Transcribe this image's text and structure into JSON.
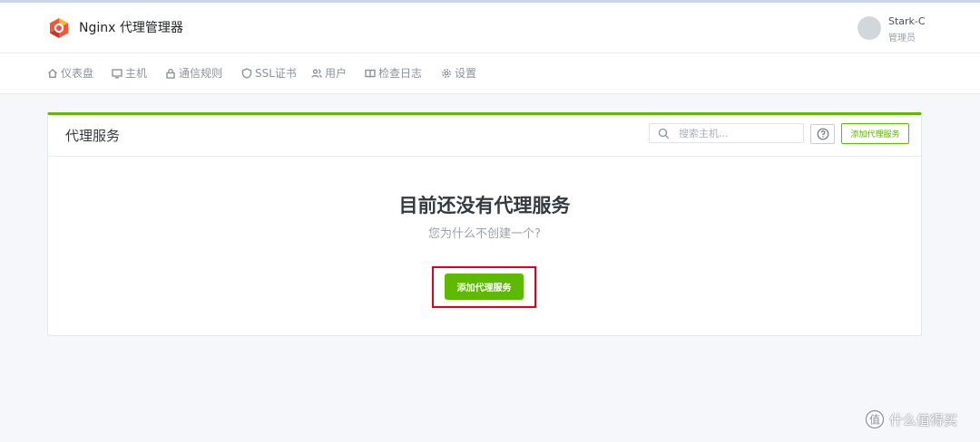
{
  "app": {
    "title": "Nginx 代理管理器"
  },
  "user": {
    "name": "Stark-C",
    "role": "管理员"
  },
  "nav": {
    "items": [
      {
        "label": "仪表盘",
        "icon": "home-icon"
      },
      {
        "label": "主机",
        "icon": "monitor-icon"
      },
      {
        "label": "通信规则",
        "icon": "lock-icon"
      },
      {
        "label": "SSL证书",
        "icon": "shield-icon"
      },
      {
        "label": "用户",
        "icon": "users-icon"
      },
      {
        "label": "检查日志",
        "icon": "book-icon"
      },
      {
        "label": "设置",
        "icon": "gear-icon"
      }
    ]
  },
  "card": {
    "title": "代理服务",
    "search_placeholder": "搜索主机...",
    "help_icon": "question-icon",
    "add_label": "添加代理服务"
  },
  "empty": {
    "title": "目前还没有代理服务",
    "subtitle": "您为什么不创建一个?",
    "button_label": "添加代理服务"
  },
  "watermark": {
    "text": "什么值得买"
  },
  "colors": {
    "accent": "#5eba00",
    "highlight": "#e0001b"
  }
}
